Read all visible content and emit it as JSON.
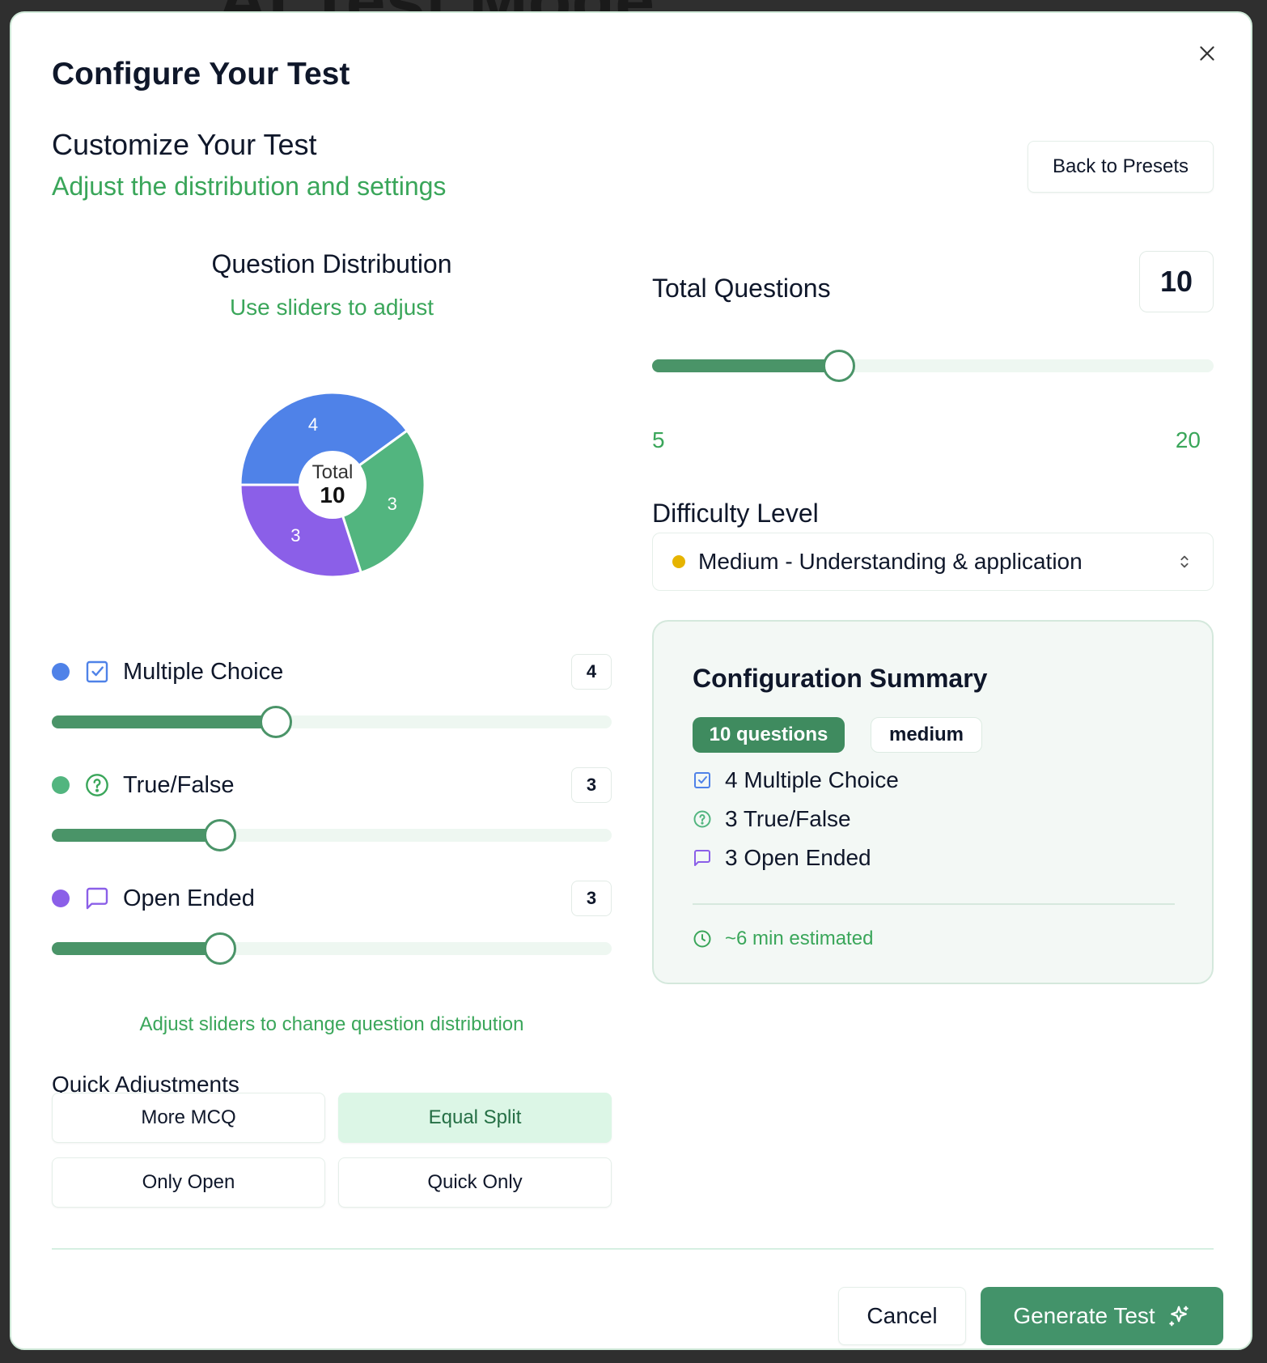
{
  "background_title": "AI Test Mode",
  "modal": {
    "title": "Configure Your Test",
    "subtitle": "Customize Your Test",
    "description": "Adjust the distribution and settings",
    "back_label": "Back to Presets"
  },
  "distribution": {
    "title": "Question Distribution",
    "subtitle": "Use sliders to adjust",
    "pie": {
      "center_label": "Total",
      "center_value": "10",
      "slices": [
        {
          "label": "4",
          "value": 4,
          "color": "#4f82e8"
        },
        {
          "label": "3",
          "value": 3,
          "color": "#52b57f"
        },
        {
          "label": "3",
          "value": 3,
          "color": "#8b5fe8"
        }
      ]
    },
    "types": [
      {
        "label": "Multiple Choice",
        "count": "4",
        "value": 4,
        "max": 10,
        "color": "#4f82e8",
        "icon": "checkbox-icon"
      },
      {
        "label": "True/False",
        "count": "3",
        "value": 3,
        "max": 10,
        "color": "#52b57f",
        "icon": "question-circle-icon"
      },
      {
        "label": "Open Ended",
        "count": "3",
        "value": 3,
        "max": 10,
        "color": "#8b5fe8",
        "icon": "message-square-icon"
      }
    ],
    "hint": "Adjust sliders to change question distribution"
  },
  "quick_adjustments": {
    "title": "Quick Adjustments",
    "buttons": [
      {
        "label": "More MCQ",
        "active": false
      },
      {
        "label": "Equal Split",
        "active": true
      },
      {
        "label": "Only Open",
        "active": false
      },
      {
        "label": "Quick Only",
        "active": false
      }
    ]
  },
  "total_questions": {
    "label": "Total Questions",
    "value": "10",
    "number": 10,
    "min": 5,
    "max": 20,
    "min_label": "5",
    "max_label": "20"
  },
  "difficulty": {
    "label": "Difficulty Level",
    "selected": "Medium - Understanding & application",
    "dot_color": "#e6b400"
  },
  "summary": {
    "title": "Configuration Summary",
    "badge_questions": "10 questions",
    "badge_difficulty": "medium",
    "items": [
      {
        "text": "4 Multiple Choice",
        "icon": "checkbox-icon",
        "color": "#4f82e8"
      },
      {
        "text": "3 True/False",
        "icon": "question-circle-icon",
        "color": "#52b57f"
      },
      {
        "text": "3 Open Ended",
        "icon": "message-square-icon",
        "color": "#8b5fe8"
      }
    ],
    "time": "~6 min estimated"
  },
  "footer": {
    "cancel": "Cancel",
    "generate": "Generate Test"
  },
  "colors": {
    "accent": "#43936a",
    "accent_text": "#3aa65a"
  }
}
